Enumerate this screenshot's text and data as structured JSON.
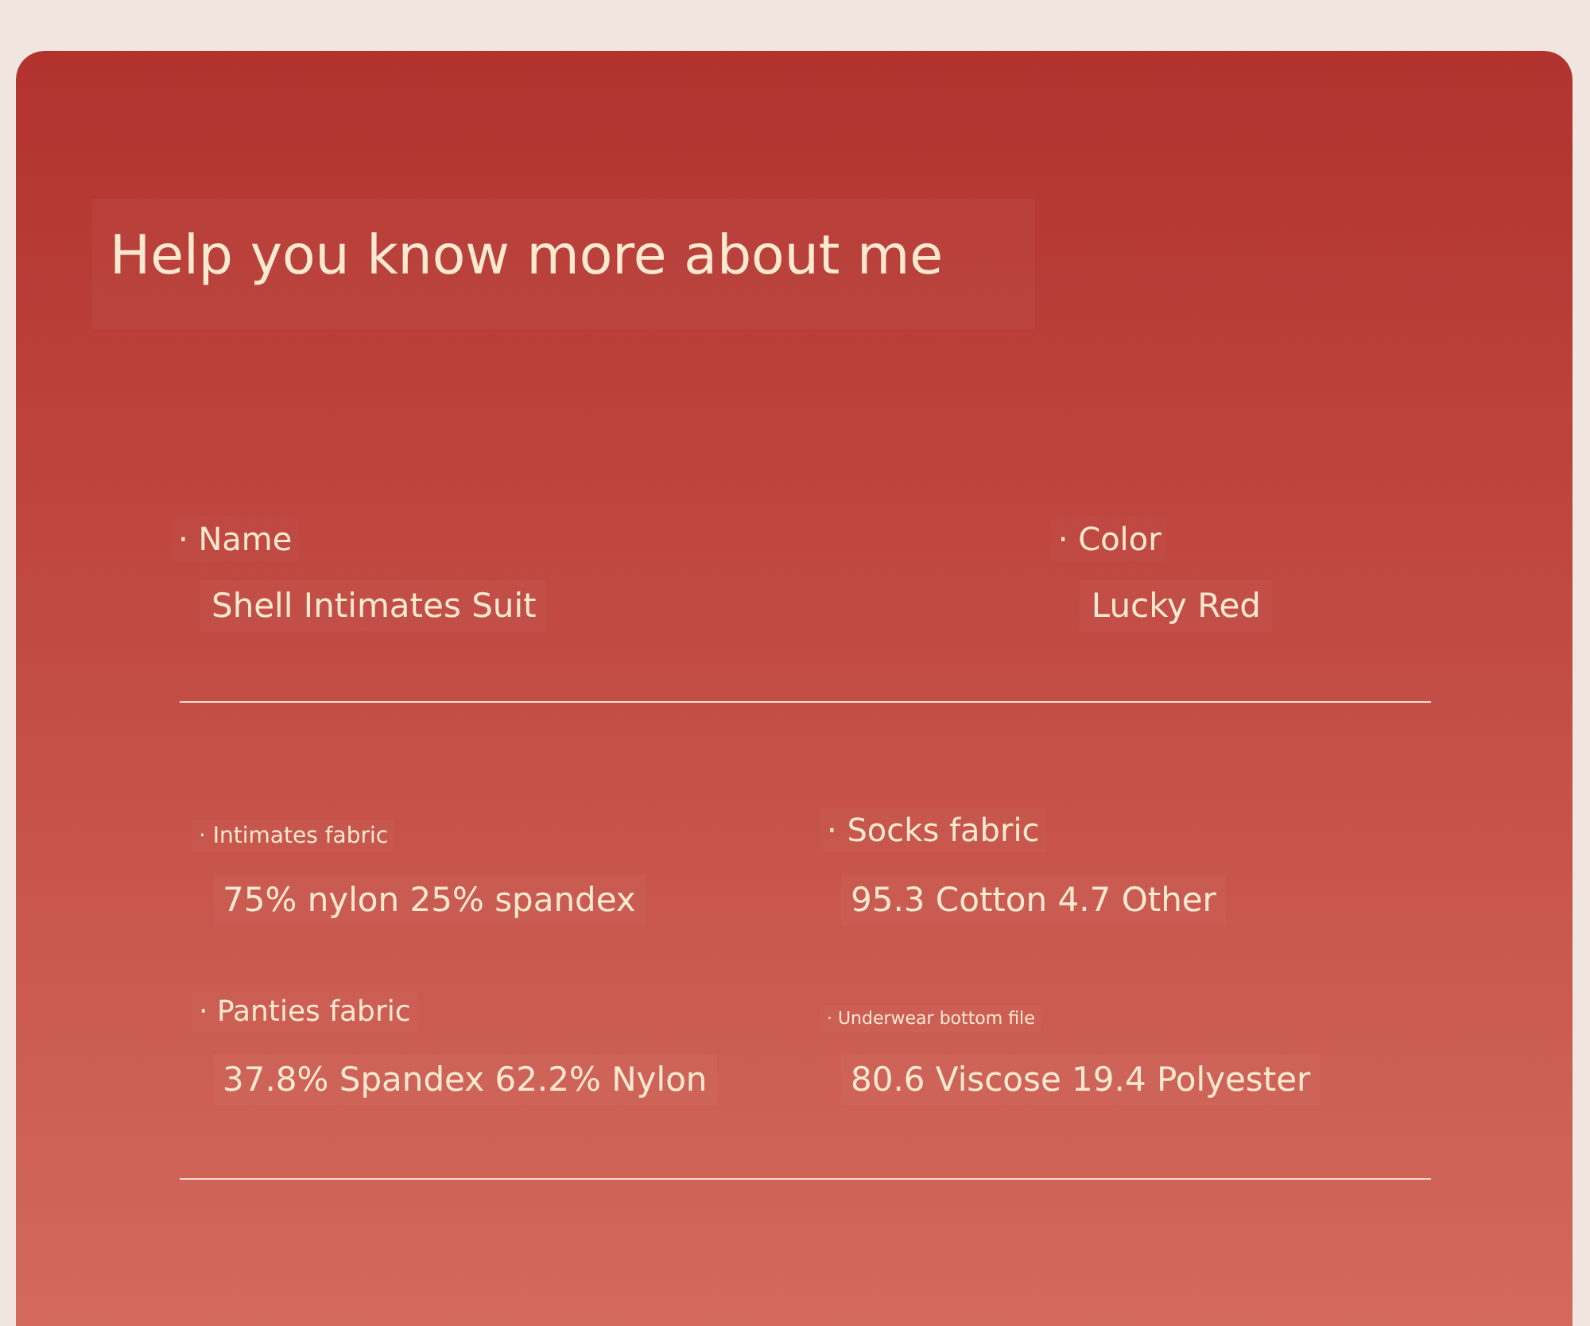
{
  "title": "Help you know more about me",
  "basics": [
    {
      "label": "· Name",
      "value": "Shell Intimates Suit"
    },
    {
      "label": "· Color",
      "value": "Lucky Red"
    }
  ],
  "fabrics": [
    {
      "label": "· Intimates fabric",
      "kind": "small",
      "value": "75% nylon 25% spandex"
    },
    {
      "label": "· Socks fabric",
      "kind": "large",
      "value": "95.3 Cotton 4.7 Other"
    },
    {
      "label": "· Panties fabric",
      "kind": "medium",
      "value": "37.8% Spandex 62.2% Nylon"
    },
    {
      "label": "· Underwear bottom file",
      "kind": "tiny",
      "value": "80.6 Viscose 19.4 Polyester"
    }
  ]
}
